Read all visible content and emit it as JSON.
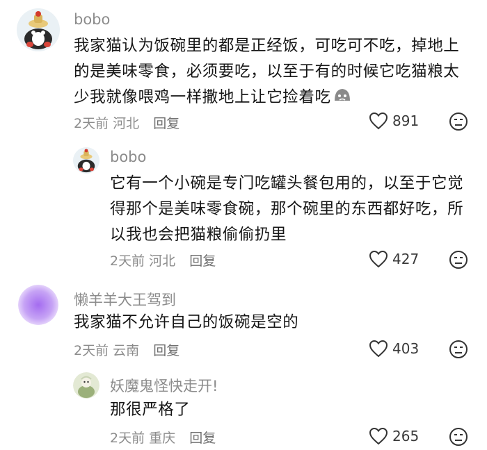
{
  "comments": [
    {
      "username": "bobo",
      "lines": [
        "我家猫认为饭碗里的都是正经饭，可吃可不吃，掉地上",
        "的是美味零食，必须要吃，以至于有的时候它吃猫粮太",
        "少我就像喂鸡一样撒地上让它捡着吃"
      ],
      "time": "2天前",
      "location": "河北",
      "reply_label": "回复",
      "likes": "891"
    },
    {
      "username": "bobo",
      "lines": [
        "它有一个小碗是专门吃罐头餐包用的，以至于它觉",
        "得那个是美味零食碗，那个碗里的东西都好吃，所",
        "以我也会把猫粮偷偷扔里"
      ],
      "time": "2天前",
      "location": "河北",
      "reply_label": "回复",
      "likes": "427"
    },
    {
      "username": "懒羊羊大王驾到",
      "lines": [
        "我家猫不允许自己的饭碗是空的"
      ],
      "time": "2天前",
      "location": "云南",
      "reply_label": "回复",
      "likes": "403"
    },
    {
      "username": "妖魔鬼怪快走开!",
      "lines": [
        "那很严格了"
      ],
      "time": "2天前",
      "location": "重庆",
      "reply_label": "回复",
      "likes": "265"
    }
  ],
  "colors": {
    "meta_gray": "#8c8c8c",
    "avatar_purple": "#b98cf2"
  }
}
